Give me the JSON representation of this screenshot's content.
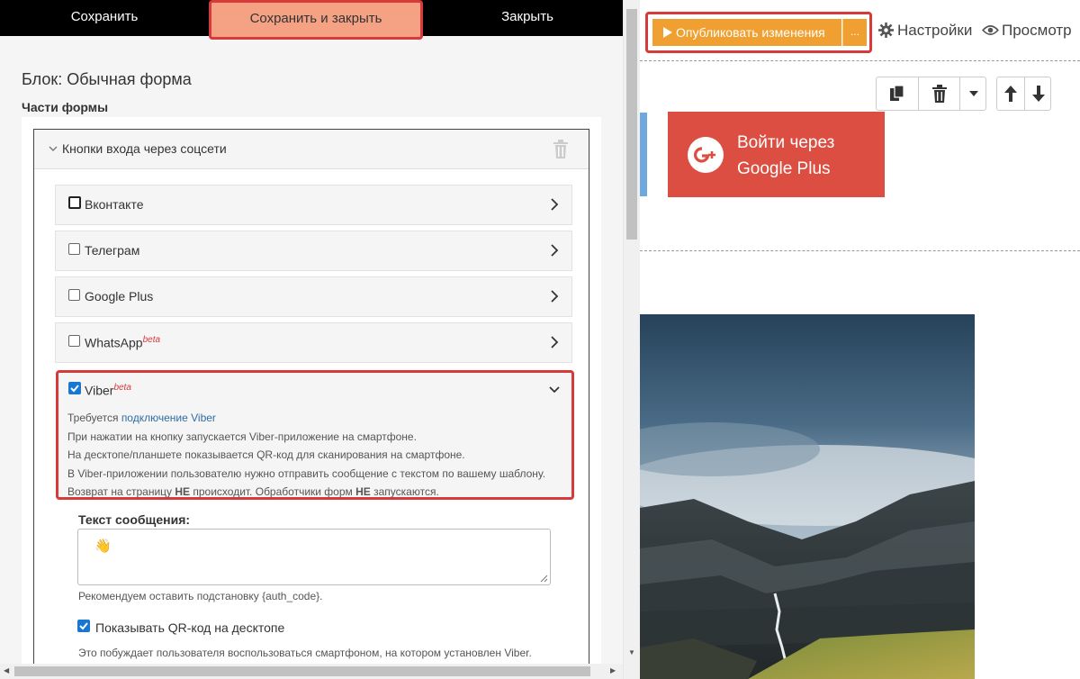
{
  "toolbar": {
    "save": "Сохранить",
    "save_close": "Сохранить и закрыть",
    "close": "Закрыть"
  },
  "panel": {
    "block_title": "Блок: Обычная форма",
    "parts_title": "Части формы",
    "group_title": "Кнопки входа через соцсети"
  },
  "items": [
    {
      "label": "Вконтакте",
      "checked": false
    },
    {
      "label": "Телеграм",
      "checked": false
    },
    {
      "label": "Google Plus",
      "checked": false
    },
    {
      "label": "WhatsApp",
      "beta": "beta",
      "checked": false
    }
  ],
  "viber": {
    "label": "Viber",
    "beta": "beta",
    "checked": true,
    "req_prefix": "Требуется ",
    "req_link": "подключение Viber",
    "line1": "При нажатии на кнопку запускается Viber-приложение на смартфоне.",
    "line2": "На десктопе/планшете показывается QR-код для сканирования на смартфоне.",
    "line3": "В Viber-приложении пользователю нужно отправить сообщение с текстом по вашему шаблону.",
    "line4_a": "Возврат на страницу ",
    "line4_b": "НЕ",
    "line4_c": " происходит. Обработчики форм ",
    "line4_d": "НЕ",
    "line4_e": " запускаются."
  },
  "message": {
    "label": "Текст сообщения:",
    "value": "👋",
    "hint": "Рекомендуем оставить подстановку {auth_code}."
  },
  "qr": {
    "label": "Показывать QR-код на десктопе",
    "checked": true,
    "hint": "Это побуждает пользователя воспользоваться смартфоном, на котором установлен Viber."
  },
  "right": {
    "publish": "Опубликовать изменения",
    "publish_more": "...",
    "settings": "Настройки",
    "preview": "Просмотр",
    "gplus_line1": "Войти через",
    "gplus_line2": "Google Plus"
  },
  "colors": {
    "accent_red": "#d63a3a",
    "publish_orange": "#f0a030",
    "gplus_red": "#dc4e41",
    "checkbox_blue": "#1976d2"
  }
}
